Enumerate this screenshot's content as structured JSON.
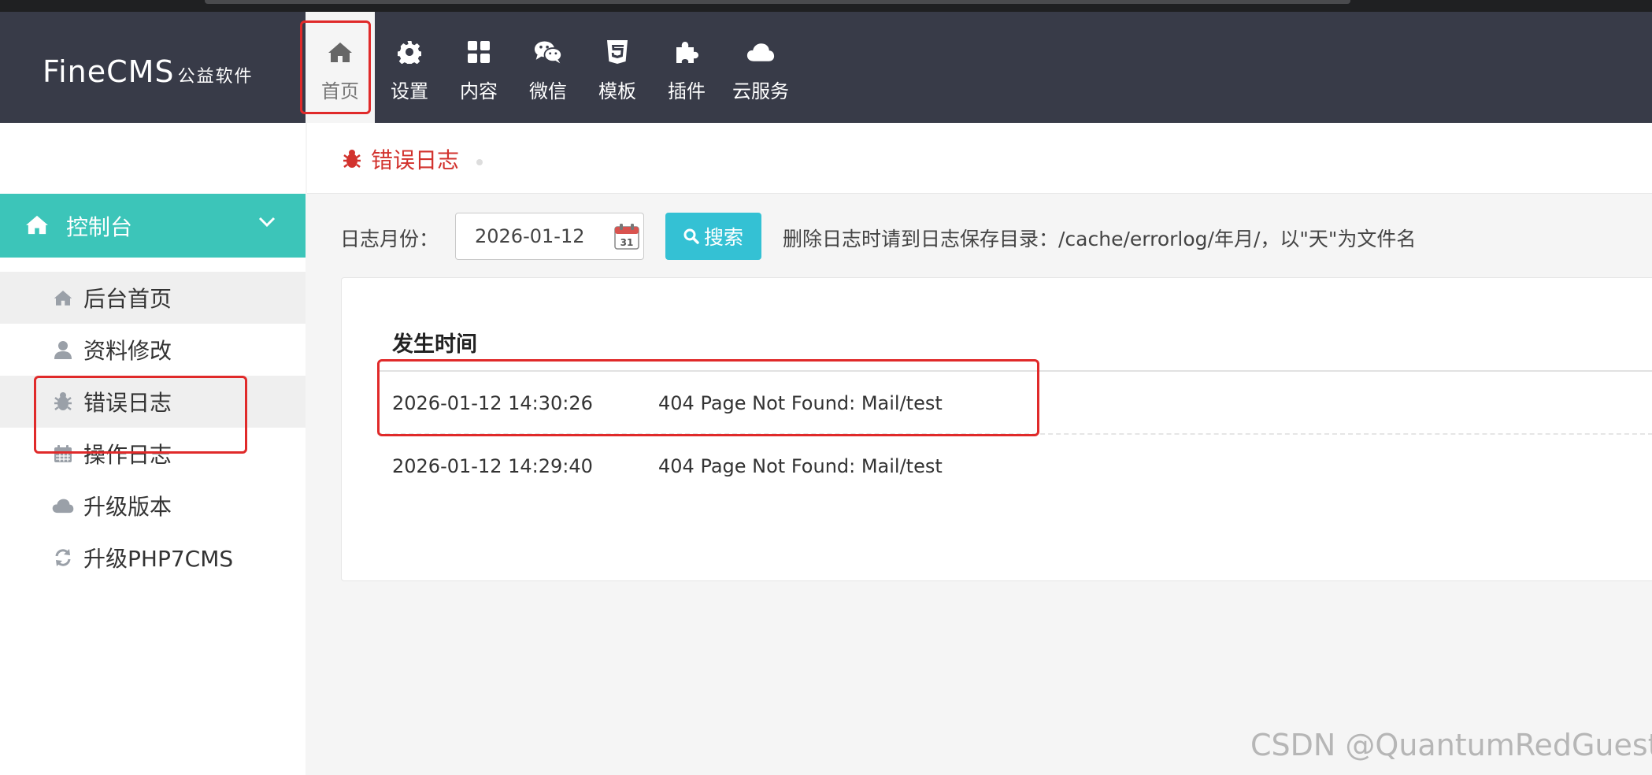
{
  "brand": {
    "logo_main": "FineCMS",
    "logo_sub": "公益软件"
  },
  "nav": [
    {
      "label": "首页",
      "icon": "home-icon",
      "active": true
    },
    {
      "label": "设置",
      "icon": "gear-icon"
    },
    {
      "label": "内容",
      "icon": "grid-icon"
    },
    {
      "label": "微信",
      "icon": "wechat-icon"
    },
    {
      "label": "模板",
      "icon": "html5-icon"
    },
    {
      "label": "插件",
      "icon": "puzzle-icon"
    },
    {
      "label": "云服务",
      "icon": "cloud-icon"
    }
  ],
  "sidebar": {
    "section": {
      "label": "控制台",
      "icon": "home-icon"
    },
    "items": [
      {
        "label": "后台首页",
        "icon": "home-icon"
      },
      {
        "label": "资料修改",
        "icon": "user-icon"
      },
      {
        "label": "错误日志",
        "icon": "bug-icon"
      },
      {
        "label": "操作日志",
        "icon": "calendar-icon"
      },
      {
        "label": "升级版本",
        "icon": "cloud-icon"
      },
      {
        "label": "升级PHP7CMS",
        "icon": "refresh-icon"
      }
    ]
  },
  "breadcrumb": {
    "label": "错误日志",
    "icon": "bug-icon"
  },
  "filter": {
    "label": "日志月份：",
    "date_value": "2026-01-12",
    "search_label": "搜索",
    "hint": "删除日志时请到日志保存目录：/cache/errorlog/年月/，以\"天\"为文件名"
  },
  "table": {
    "header": "发生时间",
    "rows": [
      {
        "time": "2026-01-12 14:30:26",
        "message": "404 Page Not Found: Mail/test"
      },
      {
        "time": "2026-01-12 14:29:40",
        "message": "404 Page Not Found: Mail/test"
      }
    ]
  },
  "watermark": "CSDN @QuantumRedGuestk",
  "colors": {
    "header_bg": "#383b48",
    "accent_teal": "#3cc5b9",
    "search_btn": "#34c1d4",
    "crumb_red": "#d2322d",
    "annotation_red": "#e02a2a"
  }
}
